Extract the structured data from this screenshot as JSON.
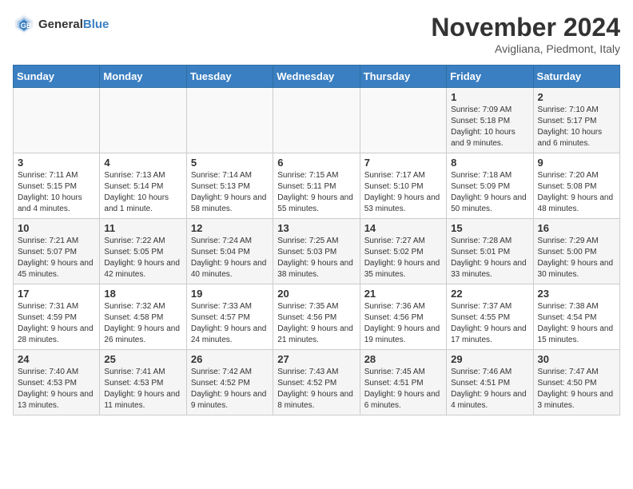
{
  "logo": {
    "line1": "General",
    "line2": "Blue"
  },
  "title": "November 2024",
  "subtitle": "Avigliana, Piedmont, Italy",
  "days_of_week": [
    "Sunday",
    "Monday",
    "Tuesday",
    "Wednesday",
    "Thursday",
    "Friday",
    "Saturday"
  ],
  "weeks": [
    [
      {
        "day": "",
        "info": ""
      },
      {
        "day": "",
        "info": ""
      },
      {
        "day": "",
        "info": ""
      },
      {
        "day": "",
        "info": ""
      },
      {
        "day": "",
        "info": ""
      },
      {
        "day": "1",
        "info": "Sunrise: 7:09 AM\nSunset: 5:18 PM\nDaylight: 10 hours and 9 minutes."
      },
      {
        "day": "2",
        "info": "Sunrise: 7:10 AM\nSunset: 5:17 PM\nDaylight: 10 hours and 6 minutes."
      }
    ],
    [
      {
        "day": "3",
        "info": "Sunrise: 7:11 AM\nSunset: 5:15 PM\nDaylight: 10 hours and 4 minutes."
      },
      {
        "day": "4",
        "info": "Sunrise: 7:13 AM\nSunset: 5:14 PM\nDaylight: 10 hours and 1 minute."
      },
      {
        "day": "5",
        "info": "Sunrise: 7:14 AM\nSunset: 5:13 PM\nDaylight: 9 hours and 58 minutes."
      },
      {
        "day": "6",
        "info": "Sunrise: 7:15 AM\nSunset: 5:11 PM\nDaylight: 9 hours and 55 minutes."
      },
      {
        "day": "7",
        "info": "Sunrise: 7:17 AM\nSunset: 5:10 PM\nDaylight: 9 hours and 53 minutes."
      },
      {
        "day": "8",
        "info": "Sunrise: 7:18 AM\nSunset: 5:09 PM\nDaylight: 9 hours and 50 minutes."
      },
      {
        "day": "9",
        "info": "Sunrise: 7:20 AM\nSunset: 5:08 PM\nDaylight: 9 hours and 48 minutes."
      }
    ],
    [
      {
        "day": "10",
        "info": "Sunrise: 7:21 AM\nSunset: 5:07 PM\nDaylight: 9 hours and 45 minutes."
      },
      {
        "day": "11",
        "info": "Sunrise: 7:22 AM\nSunset: 5:05 PM\nDaylight: 9 hours and 42 minutes."
      },
      {
        "day": "12",
        "info": "Sunrise: 7:24 AM\nSunset: 5:04 PM\nDaylight: 9 hours and 40 minutes."
      },
      {
        "day": "13",
        "info": "Sunrise: 7:25 AM\nSunset: 5:03 PM\nDaylight: 9 hours and 38 minutes."
      },
      {
        "day": "14",
        "info": "Sunrise: 7:27 AM\nSunset: 5:02 PM\nDaylight: 9 hours and 35 minutes."
      },
      {
        "day": "15",
        "info": "Sunrise: 7:28 AM\nSunset: 5:01 PM\nDaylight: 9 hours and 33 minutes."
      },
      {
        "day": "16",
        "info": "Sunrise: 7:29 AM\nSunset: 5:00 PM\nDaylight: 9 hours and 30 minutes."
      }
    ],
    [
      {
        "day": "17",
        "info": "Sunrise: 7:31 AM\nSunset: 4:59 PM\nDaylight: 9 hours and 28 minutes."
      },
      {
        "day": "18",
        "info": "Sunrise: 7:32 AM\nSunset: 4:58 PM\nDaylight: 9 hours and 26 minutes."
      },
      {
        "day": "19",
        "info": "Sunrise: 7:33 AM\nSunset: 4:57 PM\nDaylight: 9 hours and 24 minutes."
      },
      {
        "day": "20",
        "info": "Sunrise: 7:35 AM\nSunset: 4:56 PM\nDaylight: 9 hours and 21 minutes."
      },
      {
        "day": "21",
        "info": "Sunrise: 7:36 AM\nSunset: 4:56 PM\nDaylight: 9 hours and 19 minutes."
      },
      {
        "day": "22",
        "info": "Sunrise: 7:37 AM\nSunset: 4:55 PM\nDaylight: 9 hours and 17 minutes."
      },
      {
        "day": "23",
        "info": "Sunrise: 7:38 AM\nSunset: 4:54 PM\nDaylight: 9 hours and 15 minutes."
      }
    ],
    [
      {
        "day": "24",
        "info": "Sunrise: 7:40 AM\nSunset: 4:53 PM\nDaylight: 9 hours and 13 minutes."
      },
      {
        "day": "25",
        "info": "Sunrise: 7:41 AM\nSunset: 4:53 PM\nDaylight: 9 hours and 11 minutes."
      },
      {
        "day": "26",
        "info": "Sunrise: 7:42 AM\nSunset: 4:52 PM\nDaylight: 9 hours and 9 minutes."
      },
      {
        "day": "27",
        "info": "Sunrise: 7:43 AM\nSunset: 4:52 PM\nDaylight: 9 hours and 8 minutes."
      },
      {
        "day": "28",
        "info": "Sunrise: 7:45 AM\nSunset: 4:51 PM\nDaylight: 9 hours and 6 minutes."
      },
      {
        "day": "29",
        "info": "Sunrise: 7:46 AM\nSunset: 4:51 PM\nDaylight: 9 hours and 4 minutes."
      },
      {
        "day": "30",
        "info": "Sunrise: 7:47 AM\nSunset: 4:50 PM\nDaylight: 9 hours and 3 minutes."
      }
    ]
  ]
}
